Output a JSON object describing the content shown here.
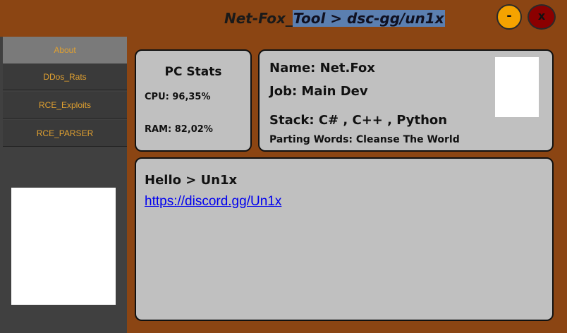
{
  "window": {
    "title_prefix": "Net-Fox_",
    "title_highlight": "Tool > dsc-gg/un1x",
    "minimize_label": "-",
    "close_label": "x",
    "colors": {
      "background": "#8B4513",
      "minimize": "#f5a300",
      "close": "#8b0000",
      "title_highlight": "#5b7fb0"
    }
  },
  "sidebar": {
    "items": [
      {
        "label": "About",
        "active": true
      },
      {
        "label": "DDos_Rats",
        "active": false
      },
      {
        "label": "RCE_Exploits",
        "active": false
      },
      {
        "label": "RCE_PARSER",
        "active": false
      }
    ],
    "accent": "#e0a030"
  },
  "stats": {
    "title": "PC Stats",
    "cpu": "CPU: 96,35%",
    "ram": "RAM: 82,02%"
  },
  "profile": {
    "name": "Name: Net.Fox",
    "job": "Job: Main Dev",
    "stack": "Stack: C# , C++ , Python",
    "words": "Parting Words: Cleanse The World"
  },
  "content": {
    "greeting": "Hello > Un1x",
    "link": "https://discord.gg/Un1x"
  }
}
